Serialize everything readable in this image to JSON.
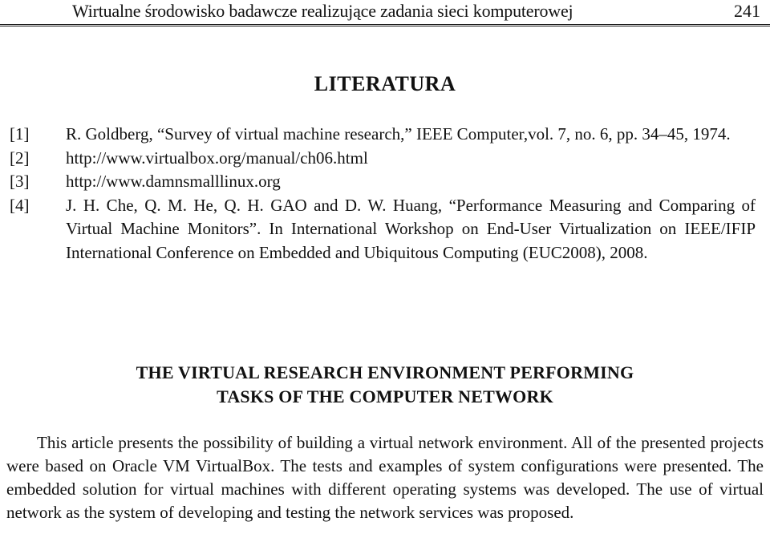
{
  "header": {
    "running_title": "Wirtualne środowisko badawcze realizujące zadania sieci komputerowej",
    "page_number": "241"
  },
  "literature": {
    "heading": "LITERATURA",
    "references": [
      {
        "num": "[1]",
        "text": "R. Goldberg, “Survey of virtual machine research,” IEEE Computer,vol. 7, no. 6, pp. 34–45, 1974."
      },
      {
        "num": "[2]",
        "text": "http://www.virtualbox.org/manual/ch06.html"
      },
      {
        "num": "[3]",
        "text": "http://www.damnsmalllinux.org"
      },
      {
        "num": "[4]",
        "text": "J. H. Che, Q. M. He, Q. H. GAO and D. W. Huang, “Performance Measuring and Comparing of Virtual Machine Monitors”. In International Workshop on End-User Virtualization on IEEE/IFIP International Conference on Embedded and Ubiquitous Computing (EUC2008), 2008."
      }
    ]
  },
  "english_title": {
    "line1": "THE VIRTUAL RESEARCH ENVIRONMENT PERFORMING",
    "line2": "TASKS OF THE COMPUTER NETWORK"
  },
  "abstract": {
    "text": "This article presents the possibility of building a virtual network environment. All of the presented projects were based on Oracle VM VirtualBox. The tests and examples of system configurations were presented. The embedded solution for virtual machines with different operating systems was developed. The use of virtual network as the system of developing and testing the network services was proposed."
  }
}
